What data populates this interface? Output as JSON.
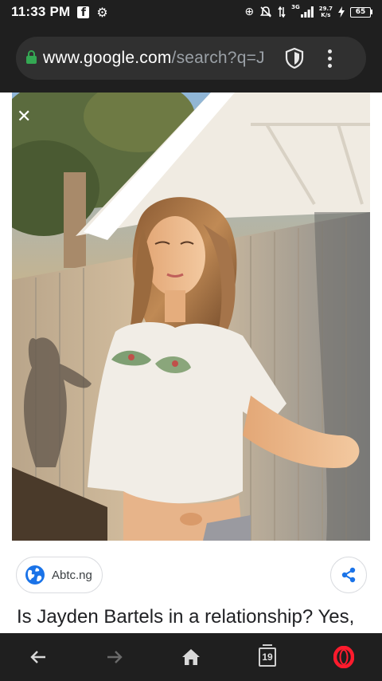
{
  "status_bar": {
    "time": "11:33 PM",
    "network_type": "3G",
    "speed_value": "29.7",
    "speed_unit": "K/s",
    "battery": "65",
    "icons": [
      "facebook-icon",
      "gear-icon",
      "data-saver-icon",
      "dnd-off-icon",
      "data-arrows-icon",
      "signal-icon",
      "charging-icon",
      "battery-icon"
    ]
  },
  "toolbar": {
    "url_host": "www.google.com",
    "url_path": "/search?q=J",
    "icons": [
      "lock-icon",
      "shield-icon",
      "menu-icon"
    ]
  },
  "image_viewer": {
    "close_icon": "close-icon"
  },
  "source": {
    "label": "Abtc.ng",
    "icons": [
      "globe-icon",
      "share-icon"
    ]
  },
  "result": {
    "title": "Is Jayden Bartels in a relationship? Yes,"
  },
  "nav_bar": {
    "tab_count": "19",
    "icons": [
      "back-icon",
      "forward-icon",
      "home-icon",
      "tabs-icon",
      "opera-icon"
    ]
  },
  "colors": {
    "dark_bar": "#1f1f1f",
    "url_pill": "#303030",
    "lock_green": "#34a853",
    "globe_blue": "#1a73e8",
    "opera_red": "#ff1b2d"
  }
}
